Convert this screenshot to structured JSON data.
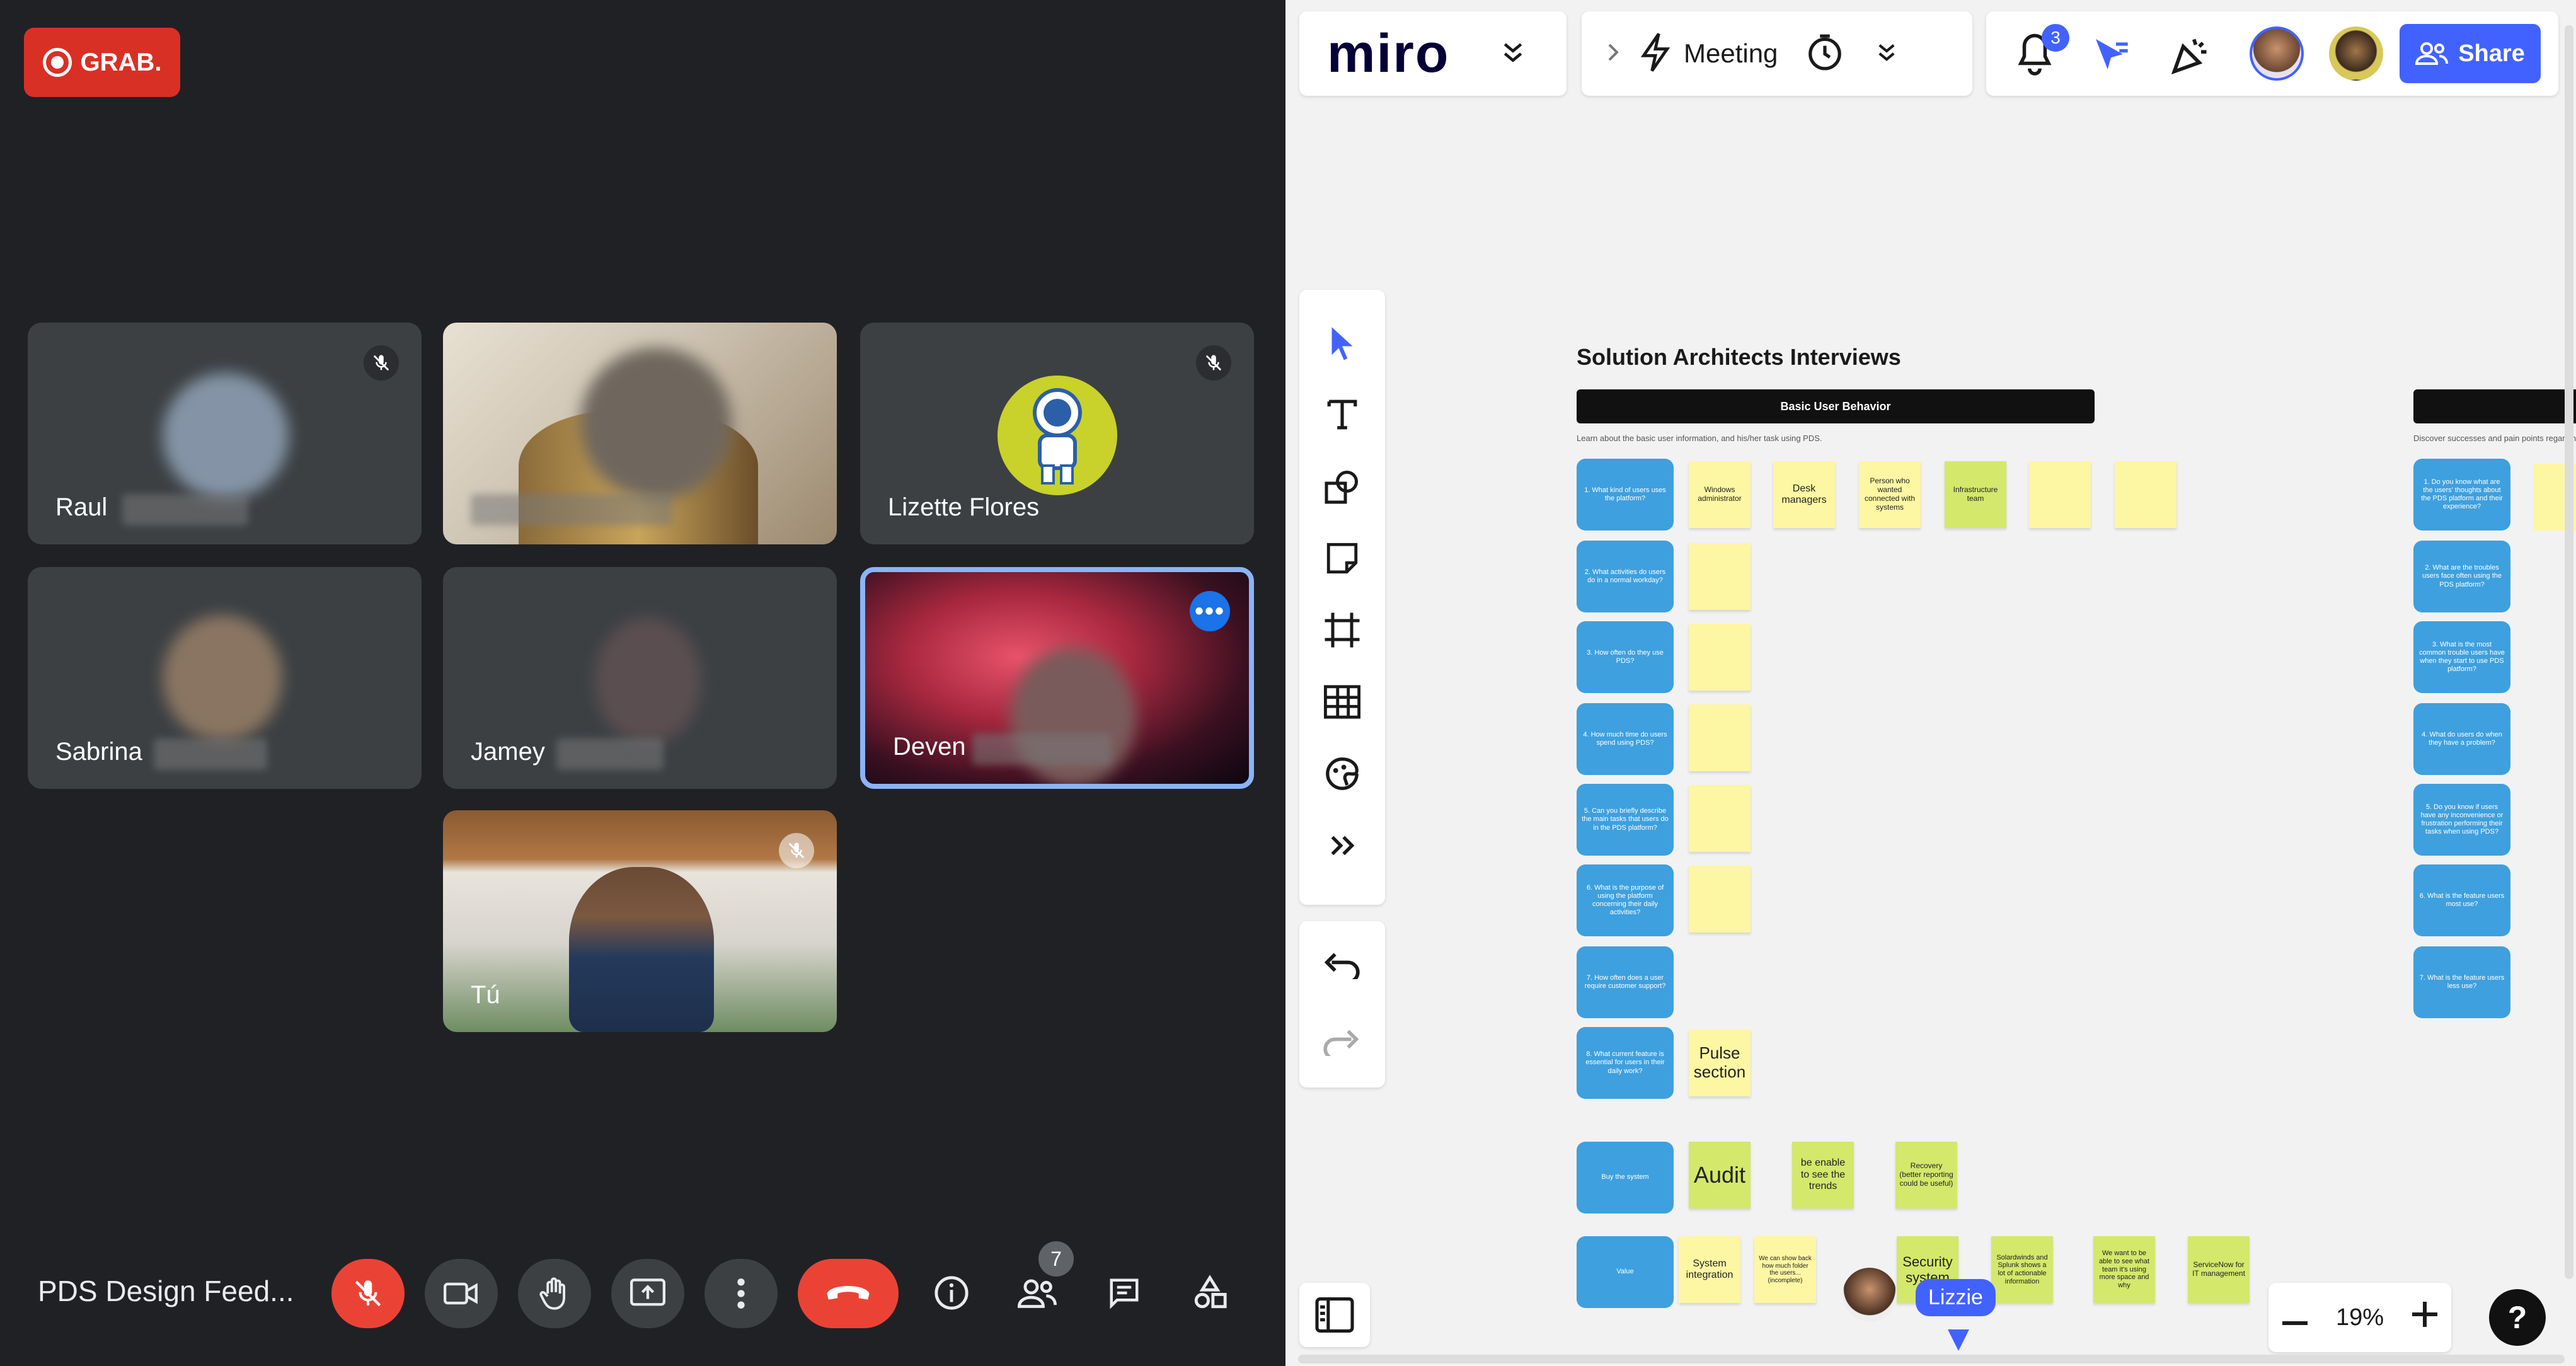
{
  "meet": {
    "recording_label": "GRAB.",
    "meeting_title": "PDS Design Feed...",
    "participant_count": "7",
    "participants": [
      {
        "name": "Raul"
      },
      {
        "name": ""
      },
      {
        "name": "Lizette Flores"
      },
      {
        "name": "Sabrina"
      },
      {
        "name": "Jamey"
      },
      {
        "name": "Deven"
      },
      {
        "name": "Tú"
      }
    ],
    "tile_menu": "•••"
  },
  "miro": {
    "logo": "miro",
    "meeting_label": "Meeting",
    "notification_count": "3",
    "share_label": "Share",
    "board_title": "Solution Architects Interviews",
    "section_header": "Basic User Behavior",
    "section_subtitle": "Learn about the basic user information, and his/her task using PDS.",
    "section2_subtitle": "Discover successes and pain points regarding",
    "questions_left": [
      "1. What kind of users uses the platform?",
      "2. What activities do users do in a normal workday?",
      "3. How often do they use PDS?",
      "4. How much time do users spend using PDS?",
      "5. Can you briefly describe the main tasks that users do in the PDS platform?",
      "6. What is the purpose of using the platform concerning their daily activities?",
      "7. How often does a user require customer support?",
      "8. What current feature is essential for users in their daily work?"
    ],
    "questions_right": [
      "1. Do you know what are the users' thoughts about the PDS platform and their experience?",
      "2. What are the troubles users face often using the PDS platform?",
      "3. What is the most common trouble users have when they start to use PDS platform?",
      "4. What do users do when they have a problem?",
      "5. Do you know if users have any inconvenience or frustration performing their tasks when using PDS?",
      "6. What is the feature users most use?",
      "7. What is the feature users less use?"
    ],
    "stickies_row1": [
      "Windows administrator",
      "Desk managers",
      "Person who wanted connected with systems",
      "Infrastructure team",
      "",
      ""
    ],
    "sticky_pulse": "Pulse section",
    "buy_label": "Buy the system",
    "buy_stickies": [
      "Audit",
      "be enable to see the trends",
      "Recovery (better reporting could be useful)"
    ],
    "value_label": "Value",
    "value_stickies": [
      "System integration",
      "We can show back how much folder the users... (incomplete)",
      "Security system",
      "Solardwinds and Splunk shows a lot of actionable information",
      "We want to be able to see what team it's using more space and why",
      "ServiceNow for IT management"
    ],
    "cursor_user": "Lizzie",
    "zoom_level": "19%",
    "help": "?"
  },
  "colors": {
    "meet_bg": "#202124",
    "meet_red": "#ea4335",
    "miro_blue": "#4262ff",
    "question_blue": "#3ea0de",
    "sticky_yellow": "#fdf6a2",
    "sticky_green": "#d4e86b"
  }
}
